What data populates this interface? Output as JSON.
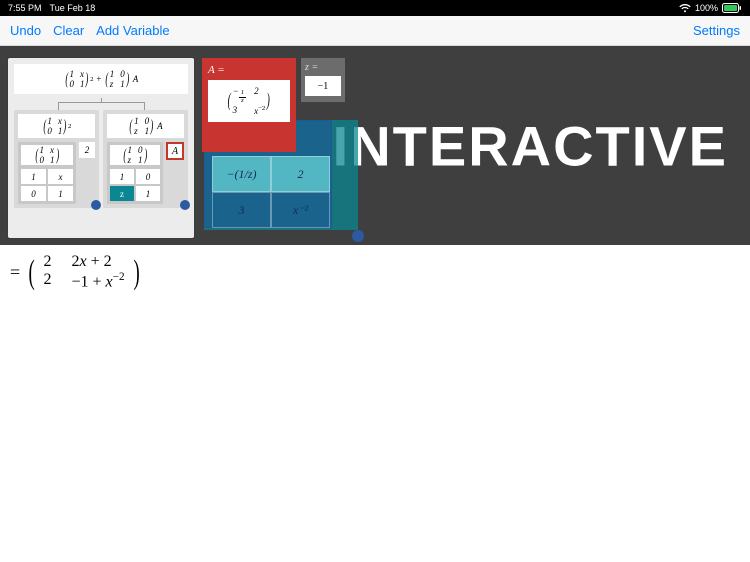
{
  "status": {
    "time": "7:55 PM",
    "date": "Tue Feb 18",
    "battery": "100%"
  },
  "toolbar": {
    "undo": "Undo",
    "clear": "Clear",
    "add_variable": "Add Variable",
    "settings": "Settings"
  },
  "hero": {
    "headline": "INTERACTIVE",
    "tree": {
      "root_expr": "(1 x; 0 1)² + (1 0; z 1) A",
      "left": {
        "expr": "(1 x; 0 1)²",
        "matrix": [
          "1",
          "x",
          "0",
          "1"
        ],
        "scalar": "2"
      },
      "right": {
        "expr": "(1 0; z 1) A",
        "matrix": [
          "1",
          "0",
          "z",
          "1"
        ],
        "var": "A"
      }
    },
    "var_A": {
      "label": "A =",
      "matrix_tex": "−(1/z)  2 ; 3  x⁻²"
    },
    "var_z": {
      "label": "z =",
      "value": "−1"
    },
    "teal_grid": [
      "−(1/z)",
      "2",
      "3",
      "x⁻²"
    ]
  },
  "result": {
    "eq": "=",
    "m11": "2",
    "m12": "2x + 2",
    "m21": "2",
    "m22": "−1 + x⁻²"
  }
}
